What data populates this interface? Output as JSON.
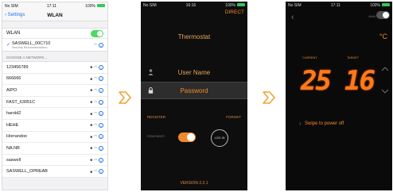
{
  "wifi": {
    "status": {
      "carrier": "No SIM",
      "time": "17:11",
      "battery": "100%"
    },
    "nav": {
      "back_label": "Settings",
      "title": "WLAN"
    },
    "wlan_label": "WLAN",
    "current_network": {
      "name": "SASWELL_00C710",
      "subtitle": "Security Recommendation"
    },
    "choose_label": "CHOOSE A NETWORK...",
    "networks": [
      "123456789",
      "666666",
      "AIPO",
      "FAST_63051C",
      "harold2",
      "HEHE",
      "Horrandoo",
      "NA.NB",
      "saswell",
      "SASWELL_OPREAB"
    ]
  },
  "login": {
    "status": {
      "carrier": "No SIM",
      "time": "16:16",
      "battery": "100%"
    },
    "direct_label": "DIRECT",
    "title": "Thermostat",
    "username_placeholder": "User Name",
    "password_placeholder": "Password",
    "register_label": "REGISTER",
    "forget_label": "FORGET",
    "remember_label": "REMEMBER",
    "login_label": "LOG IN",
    "version": "VERSION 2.2.1"
  },
  "thermostat": {
    "status": {
      "carrier": "No SIM",
      "time": "17:11",
      "battery": "100%"
    },
    "away_label": "AWAY",
    "unit": "°C",
    "current_label": "CURRENT",
    "target_label": "TARGET",
    "current_value": "25",
    "target_value": "16",
    "swipe_label": "Swipe to power off"
  },
  "colors": {
    "accent": "#f28a2d",
    "ios_blue": "#1a73e8",
    "ios_green": "#4cd964"
  }
}
